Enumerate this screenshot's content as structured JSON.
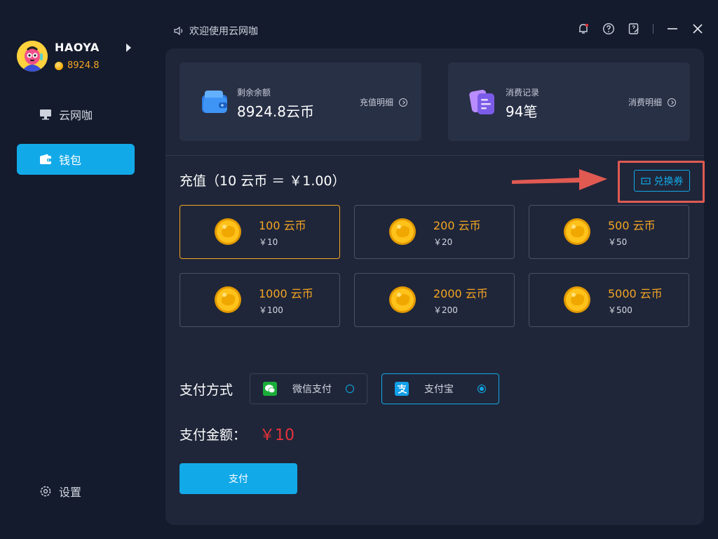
{
  "app": {
    "welcome_text": "欢迎使用云网咖"
  },
  "user": {
    "name": "HAOYA",
    "coin_balance": "8924.8"
  },
  "sidebar": {
    "items": [
      {
        "label": "云网咖",
        "icon": "monitor-icon",
        "active": false
      },
      {
        "label": "钱包",
        "icon": "wallet-icon",
        "active": true
      }
    ],
    "settings_label": "设置"
  },
  "top_icons": [
    "bell-icon",
    "help-icon",
    "feedback-icon",
    "minimize-icon",
    "close-icon"
  ],
  "stats": {
    "balance": {
      "label": "剩余余额",
      "value": "8924.8云币",
      "link": "充值明细"
    },
    "records": {
      "label": "消费记录",
      "value": "94笔",
      "link": "消费明细"
    }
  },
  "recharge": {
    "title": "充值（10 云币 ＝ ￥1.00）",
    "redeem_label": "兑换券",
    "options": [
      {
        "coins": "100 云币",
        "price": "￥10",
        "selected": true
      },
      {
        "coins": "200 云币",
        "price": "￥20",
        "selected": false
      },
      {
        "coins": "500 云币",
        "price": "￥50",
        "selected": false
      },
      {
        "coins": "1000 云币",
        "price": "￥100",
        "selected": false
      },
      {
        "coins": "2000 云币",
        "price": "￥200",
        "selected": false
      },
      {
        "coins": "5000 云币",
        "price": "￥500",
        "selected": false
      }
    ]
  },
  "payment": {
    "label": "支付方式",
    "methods": [
      {
        "name": "微信支付",
        "selected": false
      },
      {
        "name": "支付宝",
        "selected": true
      }
    ],
    "amount_label": "支付金额：",
    "amount_value": "￥10",
    "pay_button": "支付"
  },
  "colors": {
    "accent": "#12a9e8",
    "coin": "#f5a524",
    "price_red": "#e5333a",
    "highlight": "#e05a52"
  }
}
